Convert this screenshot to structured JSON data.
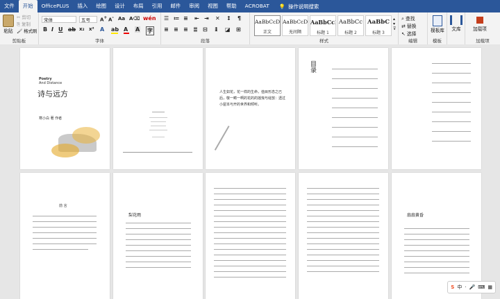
{
  "tabs": [
    "文件",
    "开始",
    "OfficePLUS",
    "插入",
    "绘图",
    "设计",
    "布局",
    "引用",
    "邮件",
    "审阅",
    "视图",
    "帮助",
    "ACROBAT"
  ],
  "tell_me": "操作说明搜索",
  "clipboard": {
    "paste": "粘贴",
    "cut": "剪切",
    "copy": "复制",
    "format_painter": "格式刷",
    "label": "剪贴板"
  },
  "font": {
    "name": "宋体",
    "size": "五号",
    "label": "字体"
  },
  "paragraph": {
    "label": "段落"
  },
  "styles": {
    "items": [
      {
        "preview": "AaBbCcDdE",
        "name": "正文"
      },
      {
        "preview": "AaBbCcDdE",
        "name": "无间隔"
      },
      {
        "preview": "AaBbCcE",
        "name": "标题 1"
      },
      {
        "preview": "AaBbCc",
        "name": "标题 2"
      },
      {
        "preview": "AaBbC",
        "name": "标题 3"
      }
    ],
    "label": "样式"
  },
  "editing": {
    "find": "查找",
    "replace": "替换",
    "select": "选择",
    "label": "编辑"
  },
  "template": {
    "btn": "模板库",
    "label": "模板"
  },
  "doc": {
    "btn": "文库"
  },
  "addins": {
    "btn": "加载项",
    "label": "加载项"
  },
  "pages": {
    "cover_title": "诗与远方",
    "cover_en1": "Poetry",
    "cover_en2": "And Distance",
    "cover_author": "寒小白 著 作者",
    "poem": "人生如花，花一样的生命，值目形态之已后，敬一畴一啊的花的的摇曳与绽放：透过小屋本与开的世界和倾听。",
    "toc_title": "目录",
    "page_title_a": "梨花雨",
    "page_title_b": "扇扇黄昏",
    "page_heading": "前 言"
  },
  "ime": {
    "logo": "S",
    "mode": "中"
  }
}
